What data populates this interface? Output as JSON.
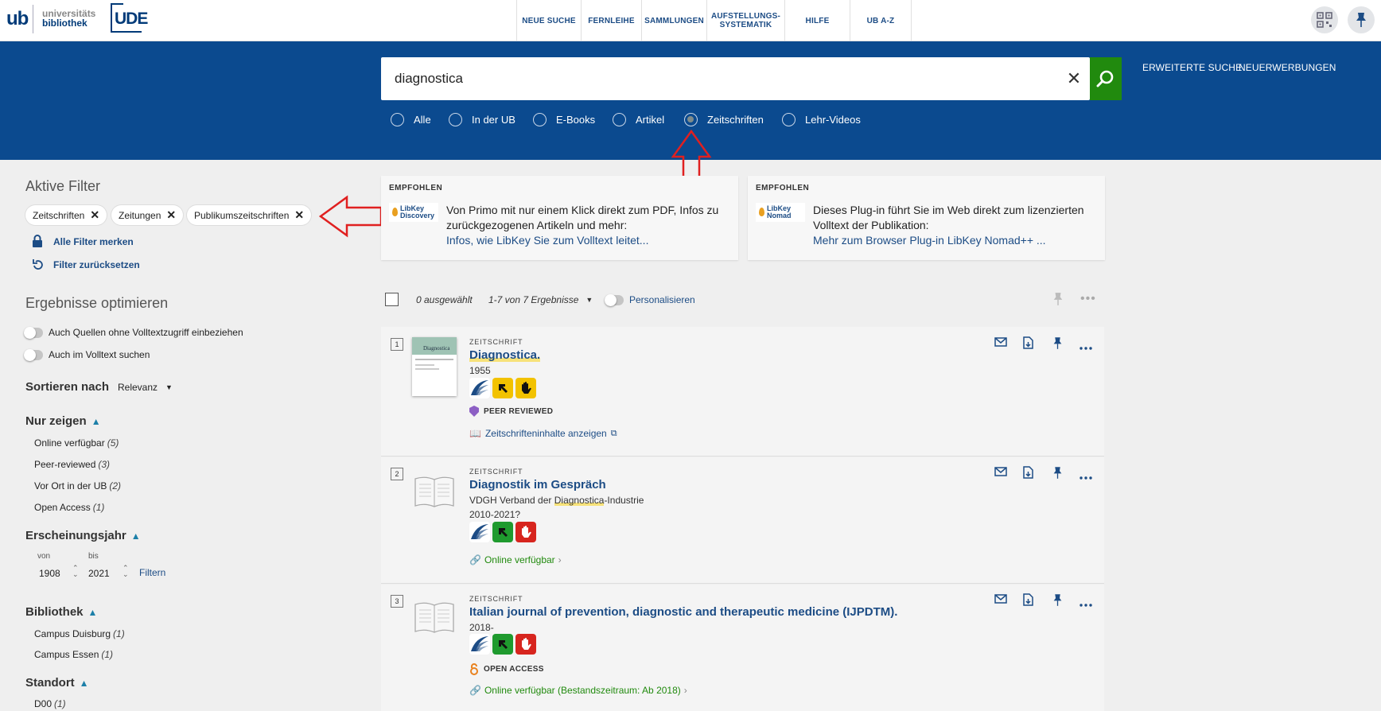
{
  "logo": {
    "ub": "ub",
    "uni_line1": "universitäts",
    "uni_line2": "bibliothek",
    "ude": "UDE"
  },
  "nav": [
    {
      "label": "NEUE SUCHE"
    },
    {
      "label": "FERNLEIHE"
    },
    {
      "label": "SAMMLUNGEN"
    },
    {
      "label": "AUFSTELLUNGS-\nSYSTEMATIK"
    },
    {
      "label": "HILFE"
    },
    {
      "label": "UB A-Z"
    }
  ],
  "search": {
    "value": "diagnostica",
    "advanced_label": "ERWEITERTE SUCHE",
    "new_label": "NEUERWERBUNGEN",
    "scopes": [
      "Alle",
      "In der UB",
      "E-Books",
      "Artikel",
      "Zeitschriften",
      "Lehr-Videos"
    ],
    "selected_scope": "Zeitschriften"
  },
  "sidebar": {
    "active_filters_title": "Aktive Filter",
    "chips": [
      "Zeitschriften",
      "Zeitungen",
      "Publikumszeitschriften"
    ],
    "remember_filters": "Alle Filter merken",
    "reset_filters": "Filter zurücksetzen",
    "optimize_title": "Ergebnisse optimieren",
    "toggle_no_fulltext": "Auch Quellen ohne Volltextzugriff einbeziehen",
    "toggle_in_fulltext": "Auch im Volltext suchen",
    "sort_label": "Sortieren nach",
    "sort_value": "Relevanz",
    "show_only_title": "Nur zeigen",
    "show_only": [
      {
        "label": "Online verfügbar",
        "count": "(5)"
      },
      {
        "label": "Peer-reviewed",
        "count": "(3)"
      },
      {
        "label": "Vor Ort in der UB",
        "count": "(2)"
      },
      {
        "label": "Open Access",
        "count": "(1)"
      }
    ],
    "year_title": "Erscheinungsjahr",
    "year_from_label": "von",
    "year_to_label": "bis",
    "year_from": "1908",
    "year_to": "2021",
    "year_filter_btn": "Filtern",
    "library_title": "Bibliothek",
    "library": [
      {
        "label": "Campus Duisburg",
        "count": "(1)"
      },
      {
        "label": "Campus Essen",
        "count": "(1)"
      }
    ],
    "location_title": "Standort",
    "location": [
      {
        "label": "D00",
        "count": "(1)"
      }
    ]
  },
  "recommendations": [
    {
      "label": "EMPFOHLEN",
      "logo_text": "LibKey Discovery",
      "text": "Von Primo mit nur einem Klick direkt zum PDF, Infos zu zurückgezogenen Artikeln und mehr:",
      "link": "Infos, wie LibKey Sie zum Volltext leitet..."
    },
    {
      "label": "EMPFOHLEN",
      "logo_text": "LibKey Nomad",
      "text": "Dieses Plug-in führt Sie im Web direkt zum lizenzierten Volltext der Publikation:",
      "link": "Mehr zum Browser Plug-in LibKey Nomad++ ..."
    }
  ],
  "results_bar": {
    "selected": "0 ausgewählt",
    "count": "1-7 von 7 Ergebnisse",
    "personalize": "Personalisieren"
  },
  "results": [
    {
      "num": "1",
      "type": "ZEITSCHRIFT",
      "title": "Diagnostica.",
      "lines": [
        "1955"
      ],
      "badge_colors": [
        "#1c4c85",
        "#f2c200",
        "#f2c200"
      ],
      "extra": "PEER REVIEWED",
      "link": "Zeitschrifteninhalte anzeigen",
      "cover": "Diagnostica"
    },
    {
      "num": "2",
      "type": "ZEITSCHRIFT",
      "title": "Diagnostik im Gespräch",
      "lines": [
        "VDGH Verband der Diagnostica-Industrie",
        "2010-2021?"
      ],
      "badge_colors": [
        "#1c4c85",
        "#1f9a2e",
        "#d7251e"
      ],
      "extra": "",
      "link": "Online verfügbar"
    },
    {
      "num": "3",
      "type": "ZEITSCHRIFT",
      "title": "Italian journal of prevention, diagnostic and therapeutic medicine (IJPDTM).",
      "lines": [
        "2018-"
      ],
      "badge_colors": [
        "#1c4c85",
        "#1f9a2e",
        "#d7251e"
      ],
      "extra": "OPEN ACCESS",
      "link": "Online verfügbar (Bestandszeitraum: Ab 2018)"
    }
  ],
  "colors": {
    "brand_blue": "#0b4a8f",
    "search_green": "#218a0e",
    "arrow_red": "#e02020"
  }
}
